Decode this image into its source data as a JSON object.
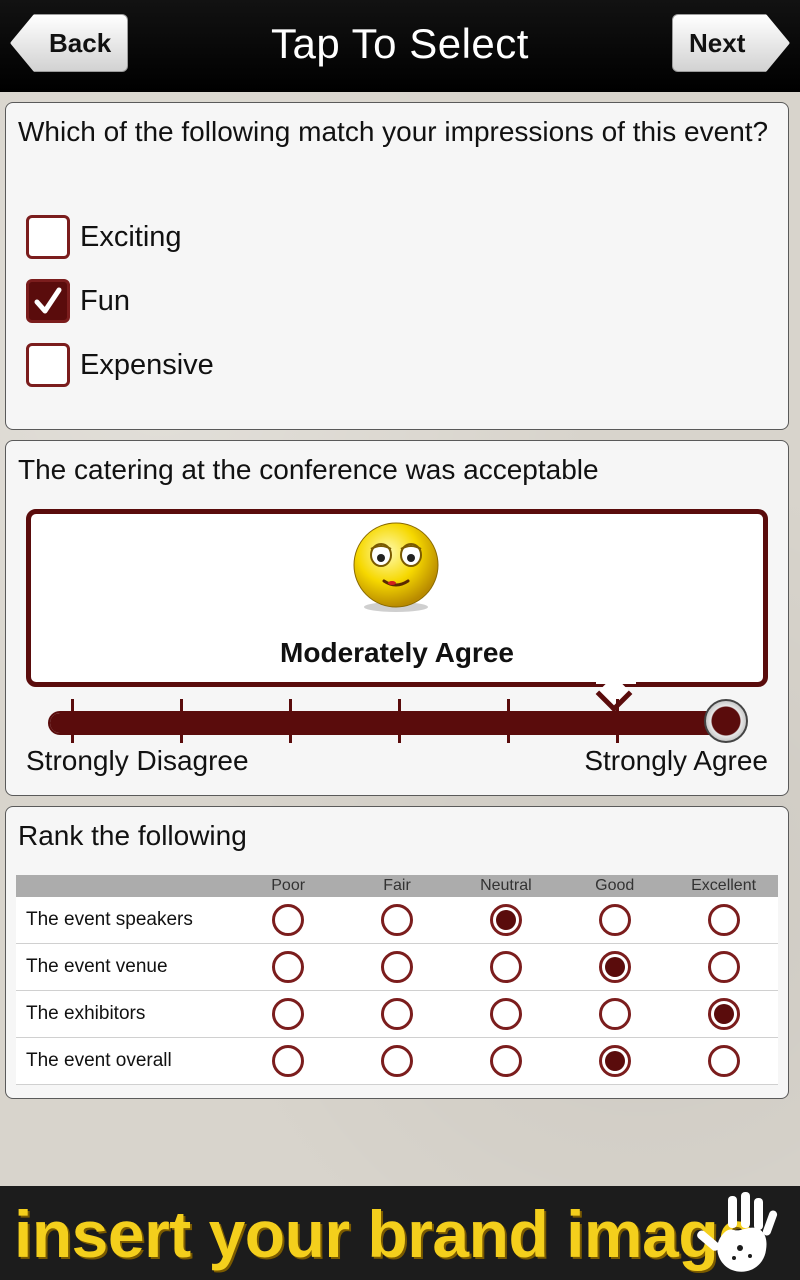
{
  "header": {
    "title": "Tap To Select",
    "back_label": "Back",
    "next_label": "Next"
  },
  "q1": {
    "question": "Which of the following match your impressions of this event?",
    "options": [
      {
        "label": "Exciting",
        "checked": false
      },
      {
        "label": "Fun",
        "checked": true
      },
      {
        "label": "Expensive",
        "checked": false
      }
    ]
  },
  "q2": {
    "question": "The catering at the conference was acceptable",
    "selected_label": "Moderately Agree",
    "scale_min_label": "Strongly Disagree",
    "scale_max_label": "Strongly Agree",
    "steps": 7,
    "selected_step": 6
  },
  "q3": {
    "question": "Rank the following",
    "columns": [
      "Poor",
      "Fair",
      "Neutral",
      "Good",
      "Excellent"
    ],
    "rows": [
      {
        "label": "The event speakers",
        "selected": 2
      },
      {
        "label": "The event venue",
        "selected": 3
      },
      {
        "label": "The exhibitors",
        "selected": 4
      },
      {
        "label": "The event overall",
        "selected": 3
      }
    ]
  },
  "brand": {
    "text": "insert your brand image"
  },
  "colors": {
    "accent": "#5a0c0c",
    "brand_yellow": "#f4cf1c"
  }
}
